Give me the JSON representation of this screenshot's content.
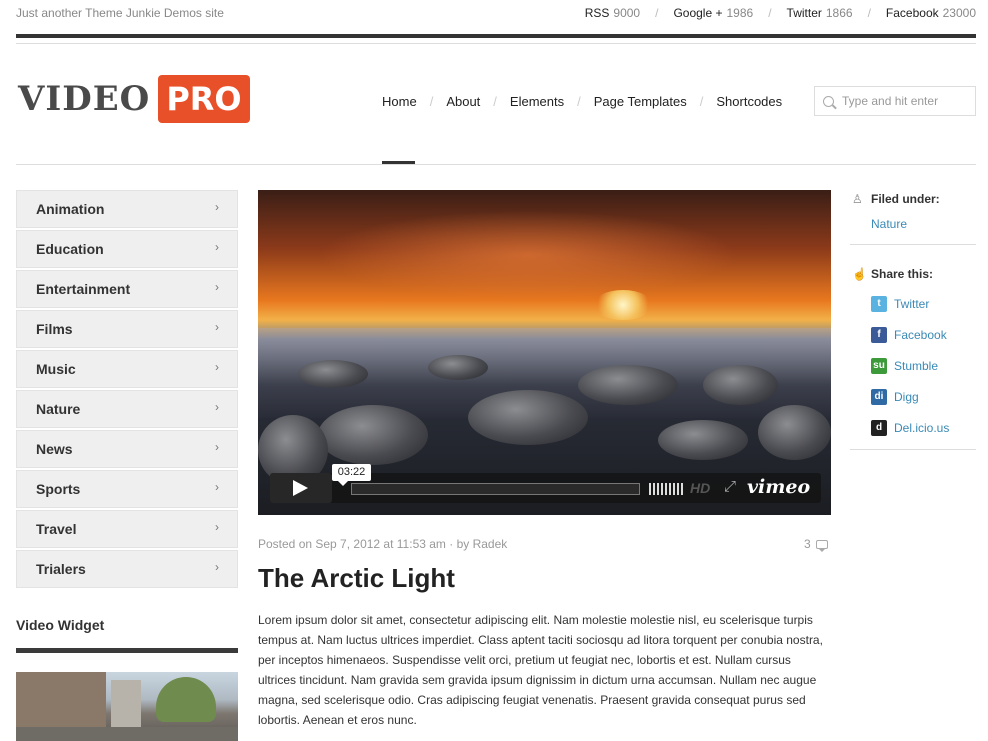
{
  "site": {
    "tagline": "Just another Theme Junkie Demos site",
    "logo_left": "VIDEO",
    "logo_right": "PRO",
    "accent": "#e8502a"
  },
  "social": [
    {
      "name": "RSS",
      "count": "9000"
    },
    {
      "name": "Google +",
      "count": "1986"
    },
    {
      "name": "Twitter",
      "count": "1866"
    },
    {
      "name": "Facebook",
      "count": "23000"
    }
  ],
  "nav": {
    "items": [
      "Home",
      "About",
      "Elements",
      "Page Templates",
      "Shortcodes"
    ],
    "active": "Home"
  },
  "search": {
    "placeholder": "Type and hit enter"
  },
  "categories": [
    "Animation",
    "Education",
    "Entertainment",
    "Films",
    "Music",
    "Nature",
    "News",
    "Sports",
    "Travel",
    "Trialers"
  ],
  "widget": {
    "title": "Video Widget"
  },
  "player": {
    "time": "03:22",
    "hd": "HD",
    "brand": "vimeo"
  },
  "post": {
    "meta": "Posted on Sep 7, 2012 at 11:53 am · by Radek",
    "comments": "3",
    "title": "The Arctic Light",
    "body": "Lorem ipsum dolor sit amet, consectetur adipiscing elit. Nam molestie molestie nisl, eu scelerisque turpis tempus at. Nam luctus ultrices imperdiet. Class aptent taciti sociosqu ad litora torquent per conubia nostra, per inceptos himenaeos. Suspendisse velit orci, pretium ut feugiat nec, lobortis et est. Nullam cursus ultrices tincidunt. Nam gravida sem gravida ipsum dignissim in dictum urna accumsan. Nullam nec augue magna, sed scelerisque odio. Cras adipiscing feugiat venenatis. Praesent gravida consequat purus sed lobortis. Aenean et eros nunc."
  },
  "sidebar_right": {
    "filed_label": "Filed under:",
    "filed_value": "Nature",
    "share_label": "Share this:",
    "share": [
      {
        "name": "Twitter",
        "color": "#5ab2e0",
        "glyph": "t"
      },
      {
        "name": "Facebook",
        "color": "#3b5b98",
        "glyph": "f"
      },
      {
        "name": "Stumble",
        "color": "#3d9a3a",
        "glyph": "su"
      },
      {
        "name": "Digg",
        "color": "#2f6aa5",
        "glyph": "di"
      },
      {
        "name": "Del.icio.us",
        "color": "#222222",
        "glyph": "d"
      }
    ]
  }
}
